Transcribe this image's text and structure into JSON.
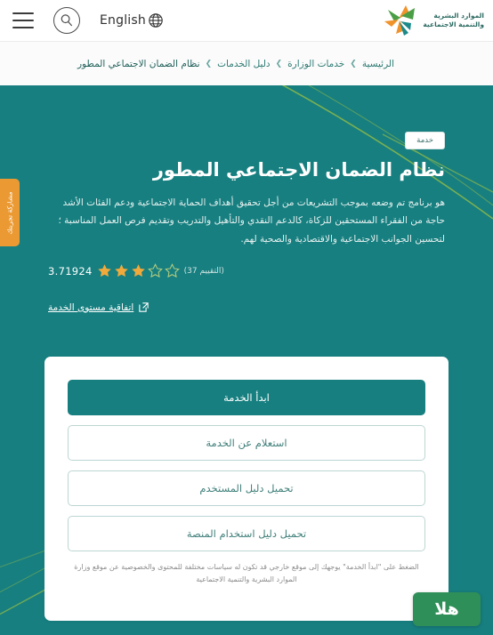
{
  "header": {
    "menu_icon": "hamburger-menu-icon",
    "search_icon": "search-icon",
    "language_label": "English",
    "globe_icon": "globe-icon",
    "logo": {
      "line1": "الموارد البشرية",
      "line2": "والتنمية الاجتماعية",
      "icon": "ministry-logo-icon",
      "colors": {
        "green": "#4a9e45",
        "orange": "#f0932b",
        "teal": "#1c8a8a"
      }
    }
  },
  "breadcrumb": {
    "items": [
      {
        "label": "الرئيسية"
      },
      {
        "label": "خدمات الوزارة"
      },
      {
        "label": "دليل الخدمات"
      },
      {
        "label": "نظام الضمان الاجتماعي المطور"
      }
    ],
    "separator": "❯"
  },
  "hero": {
    "badge": "خدمة",
    "title": "نظام الضمان الاجتماعي المطور",
    "description": "هو برنامج تم وضعه بموجب التشريعات من أجل تحقيق أهداف الحماية الاجتماعية ودعم الفئات الأشد حاجة من الفقراء المستحقين للزكاة، كالدعم النقدي والتأهيل والتدريب وتقديم فرص العمل المناسبة ؛ لتحسين الجوانب الاجتماعية والاقتصادية والصحية لهم.",
    "rating": {
      "value": "3.71924",
      "count_label": "(التقييم 37)",
      "stars_filled": 3,
      "stars_total": 5,
      "star_color": "#f0a93b"
    },
    "sla_link": {
      "label": "اتفاقية مستوى الخدمة",
      "icon": "external-link-icon"
    },
    "background_color": "#177f80",
    "decor_line_color": "#8cb84a"
  },
  "side_tab": {
    "label": "مشاركة تجربتك",
    "color": "#eb9a33"
  },
  "card": {
    "buttons": [
      {
        "label": "ابدأ الخدمة",
        "style": "primary",
        "name": "start-service-button"
      },
      {
        "label": "استعلام عن الخدمة",
        "style": "outline",
        "name": "service-inquiry-button"
      },
      {
        "label": "تحميل دليل المستخدم",
        "style": "outline",
        "name": "download-user-guide-button"
      },
      {
        "label": "تحميل دليل استخدام المنصة",
        "style": "outline",
        "name": "download-platform-guide-button"
      }
    ],
    "disclaimer": "الضغط على \"ابدأ الخدمة\" يوجهك إلى موقع خارجي قد تكون له سياسات مختلفة للمحتوى والخصوصية عن موقع وزارة الموارد البشرية والتنمية الاجتماعية"
  },
  "chat_widget": {
    "label": "هلا",
    "color": "#2f8f58"
  }
}
